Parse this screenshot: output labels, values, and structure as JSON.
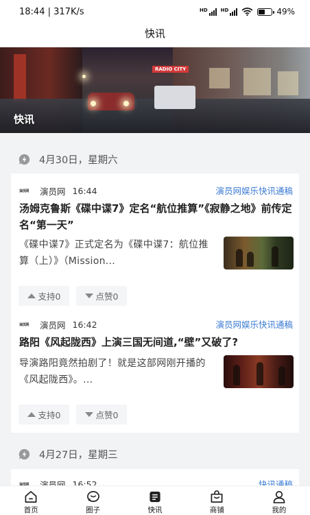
{
  "status": {
    "time": "18:44",
    "speed": "317K/s",
    "sig1": "HD",
    "sig2": "HD",
    "battery": "49",
    "battery_unit": "%",
    "battery_level": 0.49
  },
  "header": {
    "title": "快讯"
  },
  "banner": {
    "label": "快讯",
    "sign_text": "RADIO CITY"
  },
  "sections": [
    {
      "date": "4月30日，星期六",
      "items": [
        {
          "logo": "演员网",
          "source": "演员网",
          "time": "16:44",
          "tag": "演员网娱乐快讯通稿",
          "title": "汤姆克鲁斯《碟中谍7》定名“航位推算”《寂静之地》前传定名“第一天”",
          "summary": "《碟中谍7》正式定名为《碟中谍7：航位推算（上）》（Mission...",
          "support": "支持0",
          "like": "点赞0"
        },
        {
          "logo": "演员网",
          "source": "演员网",
          "time": "16:42",
          "tag": "演员网娱乐快讯通稿",
          "title": "路阳《风起陇西》上演三国无间道,“壁”又破了?",
          "summary": "导演路阳竟然拍剧了！就是这部网刚开播的《风起陇西》。...",
          "support": "支持0",
          "like": "点赞0"
        }
      ]
    },
    {
      "date": "4月27日，星期三",
      "items": [
        {
          "logo": "演员网",
          "source": "演员网",
          "time": "16:52",
          "tag": "快讯通稿"
        }
      ]
    }
  ],
  "nav": [
    {
      "label": "首页",
      "icon": "home-icon"
    },
    {
      "label": "圈子",
      "icon": "chat-bubble-icon"
    },
    {
      "label": "快讯",
      "icon": "news-icon"
    },
    {
      "label": "商铺",
      "icon": "shop-bag-icon"
    },
    {
      "label": "我的",
      "icon": "person-icon"
    }
  ]
}
